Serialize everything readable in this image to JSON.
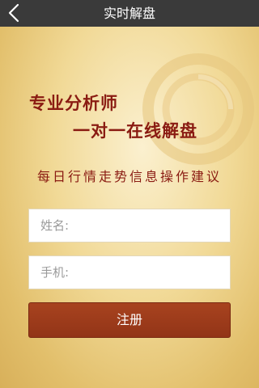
{
  "header": {
    "title": "实时解盘",
    "back_icon": "chevron-left-icon"
  },
  "banner": {
    "headline_line1": "专业分析师",
    "headline_line2": "一对一在线解盘",
    "subtitle": "每日行情走势信息操作建议",
    "watermark_icon": "ring-logo-icon"
  },
  "form": {
    "name_placeholder": "姓名:",
    "name_value": "",
    "phone_placeholder": "手机:",
    "phone_value": "",
    "submit_label": "注册"
  },
  "colors": {
    "topbar": "#3a3a3a",
    "accent_text": "#8a1b12",
    "button": "#a0401e",
    "background": "#f1d996"
  }
}
